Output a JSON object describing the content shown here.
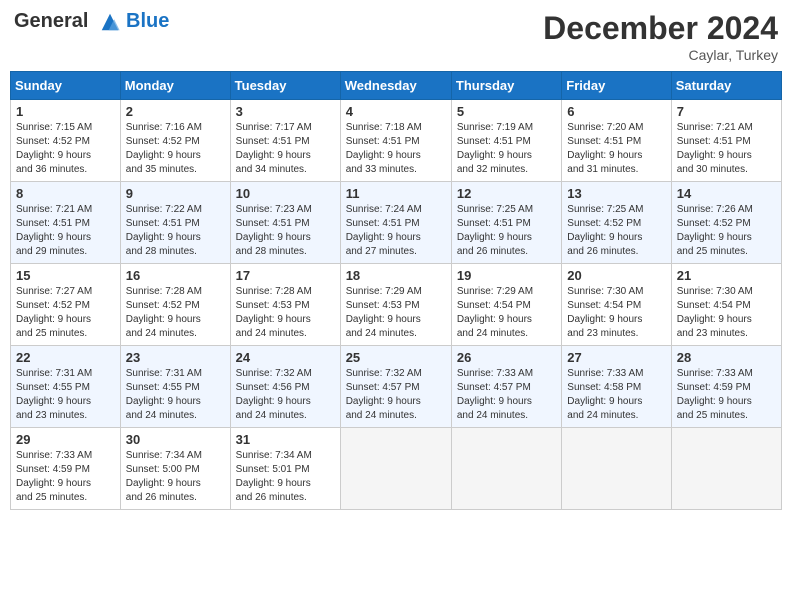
{
  "header": {
    "logo_line1": "General",
    "logo_line2": "Blue",
    "month": "December 2024",
    "location": "Caylar, Turkey"
  },
  "weekdays": [
    "Sunday",
    "Monday",
    "Tuesday",
    "Wednesday",
    "Thursday",
    "Friday",
    "Saturday"
  ],
  "weeks": [
    [
      {
        "day": "1",
        "info": "Sunrise: 7:15 AM\nSunset: 4:52 PM\nDaylight: 9 hours\nand 36 minutes."
      },
      {
        "day": "2",
        "info": "Sunrise: 7:16 AM\nSunset: 4:52 PM\nDaylight: 9 hours\nand 35 minutes."
      },
      {
        "day": "3",
        "info": "Sunrise: 7:17 AM\nSunset: 4:51 PM\nDaylight: 9 hours\nand 34 minutes."
      },
      {
        "day": "4",
        "info": "Sunrise: 7:18 AM\nSunset: 4:51 PM\nDaylight: 9 hours\nand 33 minutes."
      },
      {
        "day": "5",
        "info": "Sunrise: 7:19 AM\nSunset: 4:51 PM\nDaylight: 9 hours\nand 32 minutes."
      },
      {
        "day": "6",
        "info": "Sunrise: 7:20 AM\nSunset: 4:51 PM\nDaylight: 9 hours\nand 31 minutes."
      },
      {
        "day": "7",
        "info": "Sunrise: 7:21 AM\nSunset: 4:51 PM\nDaylight: 9 hours\nand 30 minutes."
      }
    ],
    [
      {
        "day": "8",
        "info": "Sunrise: 7:21 AM\nSunset: 4:51 PM\nDaylight: 9 hours\nand 29 minutes."
      },
      {
        "day": "9",
        "info": "Sunrise: 7:22 AM\nSunset: 4:51 PM\nDaylight: 9 hours\nand 28 minutes."
      },
      {
        "day": "10",
        "info": "Sunrise: 7:23 AM\nSunset: 4:51 PM\nDaylight: 9 hours\nand 28 minutes."
      },
      {
        "day": "11",
        "info": "Sunrise: 7:24 AM\nSunset: 4:51 PM\nDaylight: 9 hours\nand 27 minutes."
      },
      {
        "day": "12",
        "info": "Sunrise: 7:25 AM\nSunset: 4:51 PM\nDaylight: 9 hours\nand 26 minutes."
      },
      {
        "day": "13",
        "info": "Sunrise: 7:25 AM\nSunset: 4:52 PM\nDaylight: 9 hours\nand 26 minutes."
      },
      {
        "day": "14",
        "info": "Sunrise: 7:26 AM\nSunset: 4:52 PM\nDaylight: 9 hours\nand 25 minutes."
      }
    ],
    [
      {
        "day": "15",
        "info": "Sunrise: 7:27 AM\nSunset: 4:52 PM\nDaylight: 9 hours\nand 25 minutes."
      },
      {
        "day": "16",
        "info": "Sunrise: 7:28 AM\nSunset: 4:52 PM\nDaylight: 9 hours\nand 24 minutes."
      },
      {
        "day": "17",
        "info": "Sunrise: 7:28 AM\nSunset: 4:53 PM\nDaylight: 9 hours\nand 24 minutes."
      },
      {
        "day": "18",
        "info": "Sunrise: 7:29 AM\nSunset: 4:53 PM\nDaylight: 9 hours\nand 24 minutes."
      },
      {
        "day": "19",
        "info": "Sunrise: 7:29 AM\nSunset: 4:54 PM\nDaylight: 9 hours\nand 24 minutes."
      },
      {
        "day": "20",
        "info": "Sunrise: 7:30 AM\nSunset: 4:54 PM\nDaylight: 9 hours\nand 23 minutes."
      },
      {
        "day": "21",
        "info": "Sunrise: 7:30 AM\nSunset: 4:54 PM\nDaylight: 9 hours\nand 23 minutes."
      }
    ],
    [
      {
        "day": "22",
        "info": "Sunrise: 7:31 AM\nSunset: 4:55 PM\nDaylight: 9 hours\nand 23 minutes."
      },
      {
        "day": "23",
        "info": "Sunrise: 7:31 AM\nSunset: 4:55 PM\nDaylight: 9 hours\nand 24 minutes."
      },
      {
        "day": "24",
        "info": "Sunrise: 7:32 AM\nSunset: 4:56 PM\nDaylight: 9 hours\nand 24 minutes."
      },
      {
        "day": "25",
        "info": "Sunrise: 7:32 AM\nSunset: 4:57 PM\nDaylight: 9 hours\nand 24 minutes."
      },
      {
        "day": "26",
        "info": "Sunrise: 7:33 AM\nSunset: 4:57 PM\nDaylight: 9 hours\nand 24 minutes."
      },
      {
        "day": "27",
        "info": "Sunrise: 7:33 AM\nSunset: 4:58 PM\nDaylight: 9 hours\nand 24 minutes."
      },
      {
        "day": "28",
        "info": "Sunrise: 7:33 AM\nSunset: 4:59 PM\nDaylight: 9 hours\nand 25 minutes."
      }
    ],
    [
      {
        "day": "29",
        "info": "Sunrise: 7:33 AM\nSunset: 4:59 PM\nDaylight: 9 hours\nand 25 minutes."
      },
      {
        "day": "30",
        "info": "Sunrise: 7:34 AM\nSunset: 5:00 PM\nDaylight: 9 hours\nand 26 minutes."
      },
      {
        "day": "31",
        "info": "Sunrise: 7:34 AM\nSunset: 5:01 PM\nDaylight: 9 hours\nand 26 minutes."
      },
      null,
      null,
      null,
      null
    ]
  ]
}
